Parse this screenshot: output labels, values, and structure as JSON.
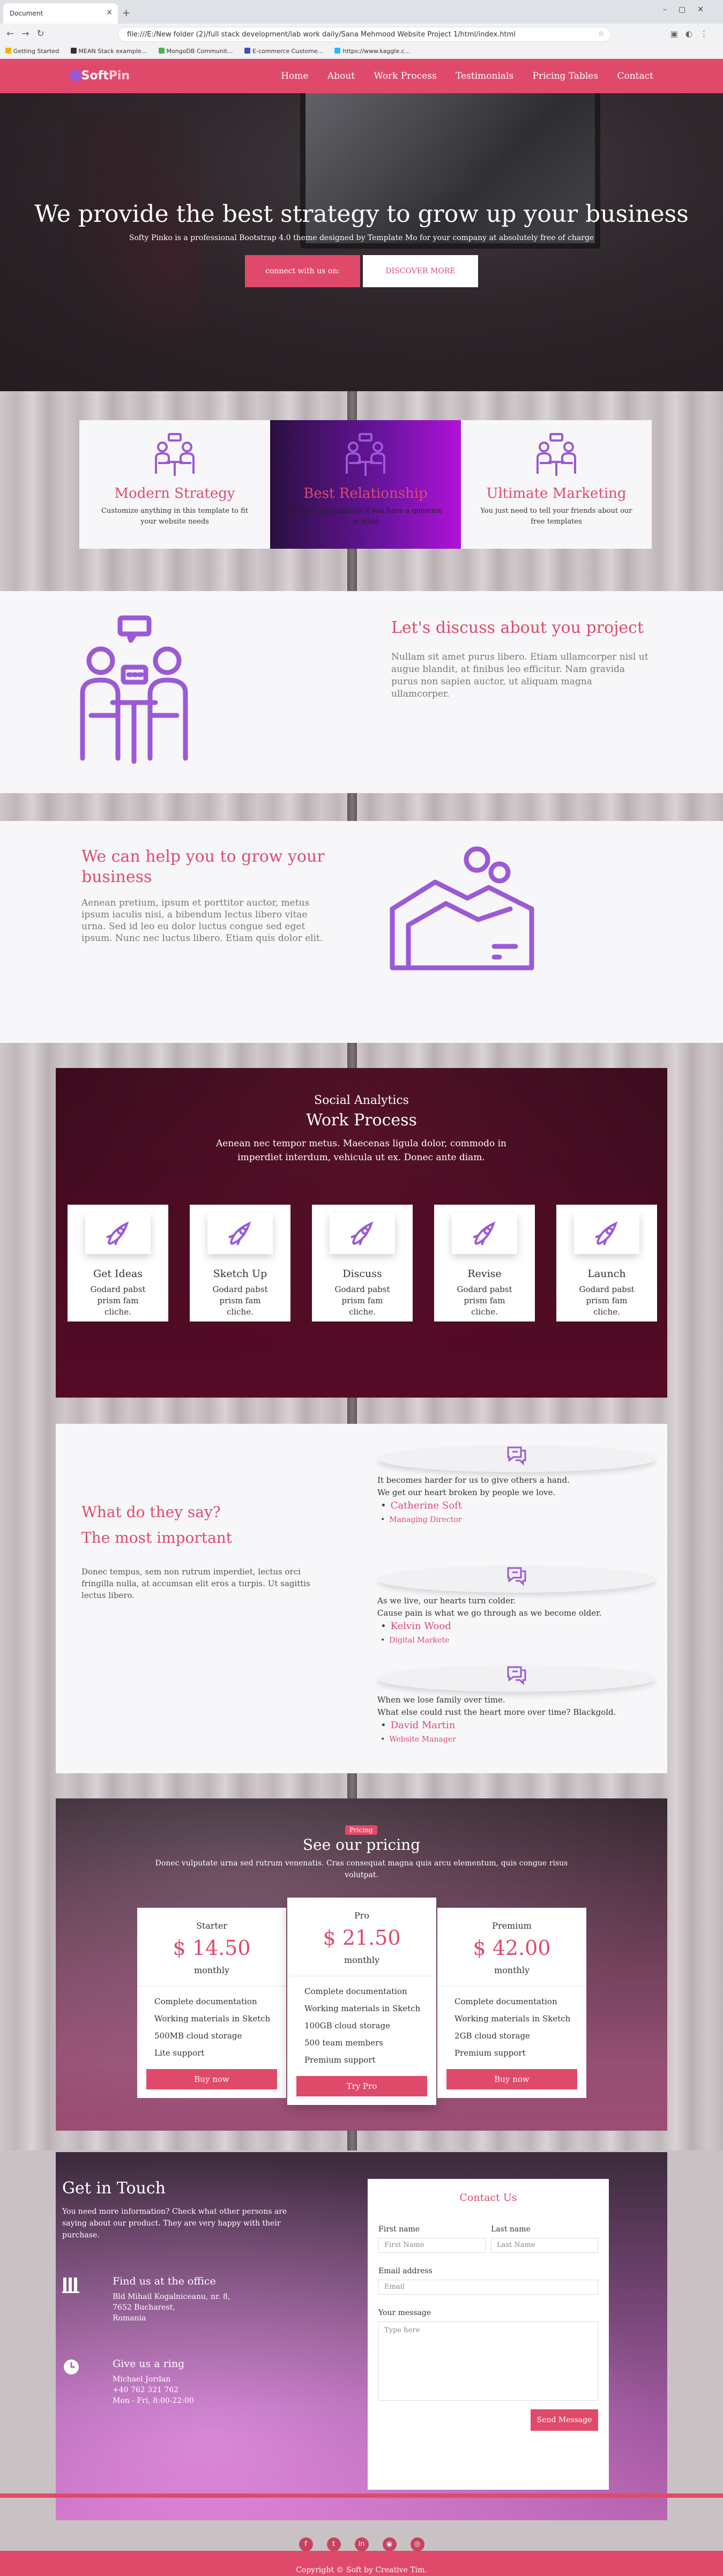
{
  "browser": {
    "tab_title": "Document",
    "url": "file:///E:/New folder (2)/full stack development/lab work daily/Sana Mehmood Website Project 1/html/index.html",
    "bookmarks": [
      "Getting Started",
      "MEAN Stack example...",
      "MongoDB Communit...",
      "E-commerce Custome...",
      "https://www.kaggle.c..."
    ]
  },
  "nav": {
    "logo_part1": "Soft",
    "logo_part2": "Pin",
    "links": [
      "Home",
      "About",
      "Work Process",
      "Testimonials",
      "Pricing Tables",
      "Contact"
    ]
  },
  "hero": {
    "title": "We provide the best strategy to grow up your business",
    "subtitle": "Softy Pinko is a professional Bootstrap 4.0 theme designed by Template Mo for your company at absolutely free of charge",
    "btn_primary": "connect with us on:",
    "btn_secondary": "DISCOVER MORE"
  },
  "features": [
    {
      "title": "Modern Strategy",
      "text": "Customize anything in this template to fit your website needs",
      "icon": "meeting-icon"
    },
    {
      "title": "Best Relationship",
      "text": "Contact immediately if you have a question in mind",
      "icon": "meeting-icon"
    },
    {
      "title": "Ultimate Marketing",
      "text": "You just need to tell your friends about our free templates",
      "icon": "meeting-icon"
    }
  ],
  "discuss": {
    "title": "Let's discuss about you project",
    "text": "Nullam sit amet purus libero. Etiam ullamcorper nisl ut augue blandit, at finibus leo efficitur. Nam gravida purus non sapien auctor, ut aliquam magna ullamcorper."
  },
  "grow": {
    "title": "We can help you to grow your business",
    "text": "Aenean pretium, ipsum et porttitor auctor, metus ipsum iaculis nisi, a bibendum lectus libero vitae urna. Sed id leo eu dolor luctus congue sed eget ipsum. Nunc nec luctus libero. Etiam quis dolor elit."
  },
  "work": {
    "kicker": "Social Analytics",
    "title": "Work Process",
    "desc": "Aenean nec tempor metus. Maecenas ligula dolor, commodo in imperdiet interdum, vehicula ut ex. Donec ante diam.",
    "steps": [
      {
        "title": "Get Ideas",
        "text": "Godard pabst prism fam cliche."
      },
      {
        "title": "Sketch Up",
        "text": "Godard pabst prism fam cliche."
      },
      {
        "title": "Discuss",
        "text": "Godard pabst prism fam cliche."
      },
      {
        "title": "Revise",
        "text": "Godard pabst prism fam cliche."
      },
      {
        "title": "Launch",
        "text": "Godard pabst prism fam cliche."
      }
    ]
  },
  "testimonials": {
    "heading1": "What do they say?",
    "heading2": "The most important",
    "text": "Donec tempus, sem non rutrum imperdiet, lectus orci fringilla nulla, at accumsan elit eros a turpis. Ut sagittis lectus libero.",
    "items": [
      {
        "line1": "It becomes harder for us to give others a hand.",
        "line2": "We get our heart broken by people we love.",
        "name": "Catherine Soft",
        "role": "Managing Director"
      },
      {
        "line1": "As we live, our hearts turn colder.",
        "line2": "Cause pain is what we go through as we become older.",
        "name": "Kelvin Wood",
        "role": "Digital Markete"
      },
      {
        "line1": "When we lose family over time.",
        "line2": "What else could rust the heart more over time? Blackgold.",
        "name": "David Martin",
        "role": "Website Manager"
      }
    ]
  },
  "pricing": {
    "badge": "Pricing",
    "title": "See our pricing",
    "desc": "Donec vulputate urna sed rutrum venenatis. Cras consequat magna quis arcu elementum, quis congue risus volutpat.",
    "plans": [
      {
        "name": "Starter",
        "price": "$ 14.50",
        "period": "monthly",
        "features": [
          "Complete documentation",
          "Working materials in Sketch",
          "500MB cloud storage",
          "Lite support"
        ],
        "button": "Buy now"
      },
      {
        "name": "Pro",
        "price": "$ 21.50",
        "period": "monthly",
        "features": [
          "Complete documentation",
          "Working materials in Sketch",
          "100GB cloud storage",
          "500 team members",
          "Premium support"
        ],
        "button": "Try Pro"
      },
      {
        "name": "Premium",
        "price": "$ 42.00",
        "period": "monthly",
        "features": [
          "Complete documentation",
          "Working materials in Sketch",
          "2GB cloud storage",
          "Premium support"
        ],
        "button": "Buy now"
      }
    ]
  },
  "contact": {
    "title": "Get in Touch",
    "text": "You need more information? Check what other persons are saying about our product. They are very happy with their purchase.",
    "office_title": "Find us at the office",
    "office_lines": [
      "Bld Mihail Kogalniceanu, nr. 8,",
      "7652 Bucharest,",
      "Romania"
    ],
    "ring_title": "Give us a ring",
    "ring_lines": [
      "Michael Jordan",
      "+40 762 321 762",
      "Mon - Fri, 8:00-22:00"
    ],
    "form": {
      "title": "Contact Us",
      "first_label": "First name",
      "first_ph": "First Name",
      "last_label": "Last name",
      "last_ph": "Last Name",
      "email_label": "Email address",
      "email_ph": "Email",
      "msg_label": "Your message",
      "msg_ph": "Type here",
      "send": "Send Message"
    }
  },
  "footer": {
    "copyright": "Copyright © Soft by Creative Tim."
  },
  "colors": {
    "accent": "#e04a6a",
    "purple": "#9b59d6"
  }
}
